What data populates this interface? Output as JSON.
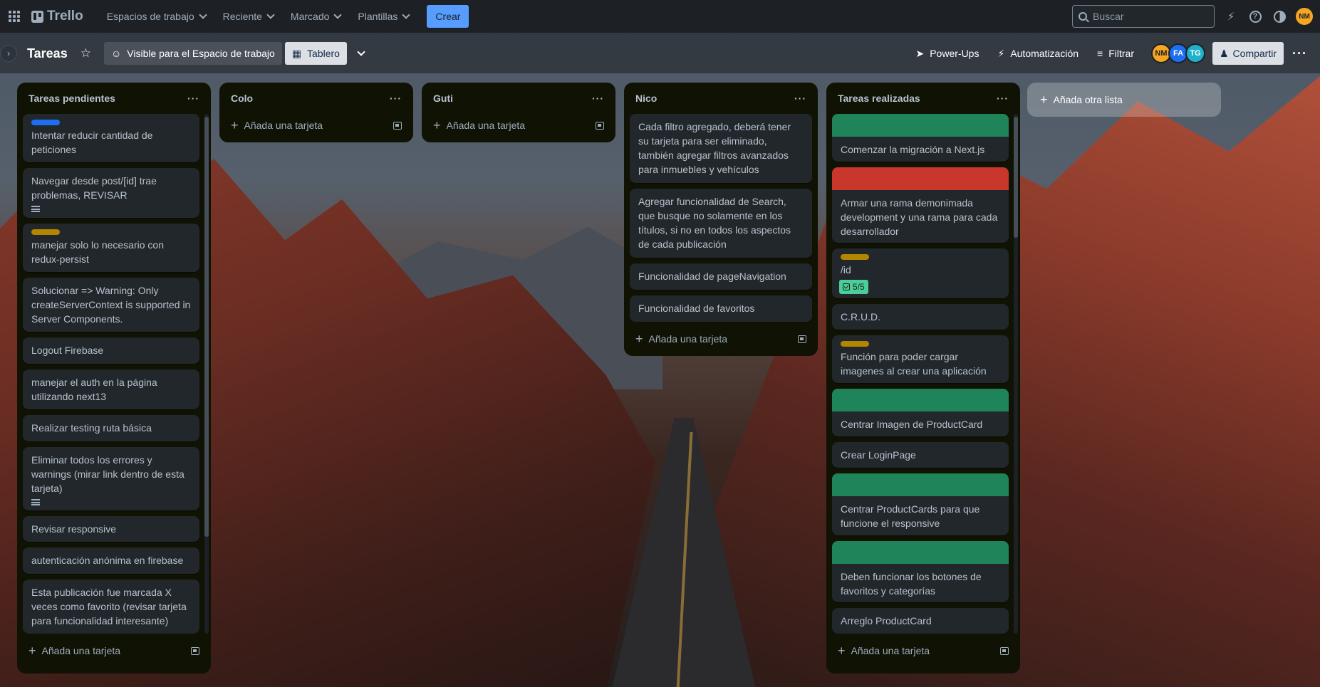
{
  "topnav": {
    "logo": "Trello",
    "menus": [
      "Espacios de trabajo",
      "Reciente",
      "Marcado",
      "Plantillas"
    ],
    "create_label": "Crear",
    "search_placeholder": "Buscar",
    "user_initials": "NM",
    "user_color": "#f5a623",
    "icons": [
      "apps-grid-icon",
      "trello-logo-icon",
      "notifications-icon",
      "help-icon",
      "theme-icon"
    ]
  },
  "board": {
    "title": "Tareas",
    "visibility_label": "Visible para el Espacio de trabajo",
    "view_label": "Tablero",
    "powerups_label": "Power-Ups",
    "automation_label": "Automatización",
    "filter_label": "Filtrar",
    "share_label": "Compartir",
    "members": [
      {
        "initials": "NM",
        "color": "#f5a623"
      },
      {
        "initials": "FA",
        "color": "#1d6ff2"
      },
      {
        "initials": "TG",
        "color": "#1fb1c9"
      }
    ]
  },
  "add_card_label": "Añada una tarjeta",
  "add_list_label": "Añada otra lista",
  "lists": [
    {
      "title": "Tareas pendientes",
      "cards": [
        {
          "text": "Intentar reducir cantidad de peticiones",
          "label_color": "#1d6ff2"
        },
        {
          "text": "Navegar desde post/[id] trae problemas, REVISAR",
          "has_description": true
        },
        {
          "text": "manejar solo lo necesario con redux-persist",
          "label_color": "#b38600"
        },
        {
          "text": "Solucionar => Warning: Only createServerContext is supported in Server Components."
        },
        {
          "text": "Logout Firebase"
        },
        {
          "text": "manejar el auth en la página utilizando next13"
        },
        {
          "text": "Realizar testing ruta básica"
        },
        {
          "text": "Eliminar todos los errores y warnings (mirar link dentro de esta tarjeta)",
          "has_description": true
        },
        {
          "text": "Revisar responsive"
        },
        {
          "text": "autenticación anónima en firebase"
        },
        {
          "text": "Esta publicación fue marcada X veces como favorito (revisar tarjeta para funcionalidad interesante)"
        }
      ]
    },
    {
      "title": "Colo",
      "cards": []
    },
    {
      "title": "Guti",
      "cards": []
    },
    {
      "title": "Nico",
      "cards": [
        {
          "text": "Cada filtro agregado, deberá tener su tarjeta para ser eliminado, también agregar filtros avanzados para inmuebles y vehículos"
        },
        {
          "text": "Agregar funcionalidad de Search, que busque no solamente en los títulos, si no en todos los aspectos de cada publicación"
        },
        {
          "text": "Funcionalidad de pageNavigation"
        },
        {
          "text": "Funcionalidad de favoritos"
        }
      ]
    },
    {
      "title": "Tareas realizadas",
      "cards": [
        {
          "text": "Comenzar la migración a Next.js",
          "cover_color": "#1f845a"
        },
        {
          "text": "Armar una rama demonimada development y una rama para cada desarrollador",
          "cover_color": "#c9372c"
        },
        {
          "text": "/id",
          "label_color": "#b38600",
          "checklist": "5/5"
        },
        {
          "text": "C.R.U.D."
        },
        {
          "text": "Función para poder cargar imagenes al crear una aplicación",
          "label_color": "#b38600"
        },
        {
          "text": "Centrar Imagen de ProductCard",
          "cover_color": "#1f845a"
        },
        {
          "text": "Crear LoginPage"
        },
        {
          "text": "Centrar ProductCards para que funcione el responsive",
          "cover_color": "#1f845a"
        },
        {
          "text": "Deben funcionar los botones de favoritos y categorías",
          "cover_color": "#1f845a"
        },
        {
          "text": "Arreglo ProductCard"
        }
      ]
    }
  ]
}
